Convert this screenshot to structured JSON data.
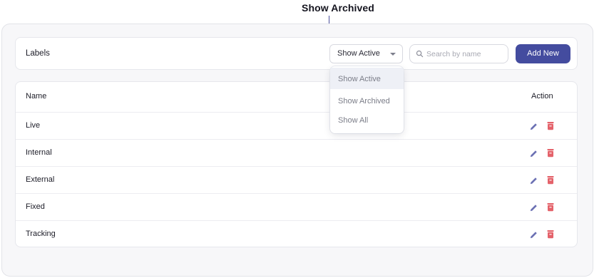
{
  "annotation": {
    "label": "Show Archived"
  },
  "toolbar": {
    "title": "Labels",
    "filter_selected": "Show Active",
    "search_placeholder": "Search by name",
    "add_label": "Add New",
    "accent_color": "#444c9f"
  },
  "filter_dropdown": {
    "options": [
      "Show Active",
      "Show Archived",
      "Show All"
    ],
    "highlighted": "Show Active"
  },
  "table": {
    "columns": {
      "name": "Name",
      "action": "Action"
    },
    "rows": [
      {
        "name": "Live"
      },
      {
        "name": "Internal"
      },
      {
        "name": "External"
      },
      {
        "name": "Fixed"
      },
      {
        "name": "Tracking"
      }
    ],
    "edit_icon": "pencil-icon",
    "delete_icon": "trash-icon",
    "edit_color": "#6b70b3",
    "delete_color": "#e4626a"
  }
}
